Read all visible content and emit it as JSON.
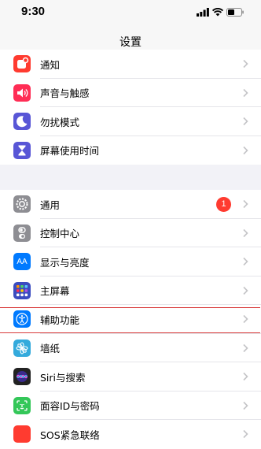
{
  "status_bar": {
    "time": "9:30"
  },
  "nav": {
    "title": "设置"
  },
  "group1": [
    {
      "label": "通知",
      "icon": "notifications-icon",
      "color": "#ff3b30"
    },
    {
      "label": "声音与触感",
      "icon": "sound-icon",
      "color": "#ff2d55"
    },
    {
      "label": "勿扰模式",
      "icon": "moon-icon",
      "color": "#5856d6"
    },
    {
      "label": "屏幕使用时间",
      "icon": "hourglass-icon",
      "color": "#5856d6"
    }
  ],
  "group2": [
    {
      "label": "通用",
      "icon": "gear-icon",
      "color": "#8e8e93",
      "badge": "1"
    },
    {
      "label": "控制中心",
      "icon": "toggles-icon",
      "color": "#8e8e93"
    },
    {
      "label": "显示与亮度",
      "icon": "display-icon",
      "color": "#007aff",
      "icon_text": "AA"
    },
    {
      "label": "主屏幕",
      "icon": "home-screen-icon",
      "color": "#3b4cc0"
    },
    {
      "label": "辅助功能",
      "icon": "accessibility-icon",
      "color": "#007aff"
    },
    {
      "label": "墙纸",
      "icon": "wallpaper-icon",
      "color": "#34aadc"
    },
    {
      "label": "Siri与搜索",
      "icon": "siri-icon",
      "color": "#222222"
    },
    {
      "label": "面容ID与密码",
      "icon": "face-id-icon",
      "color": "#34c759"
    },
    {
      "label": "SOS紧急联络",
      "icon": "sos-icon",
      "color": "#ff3b30"
    }
  ]
}
